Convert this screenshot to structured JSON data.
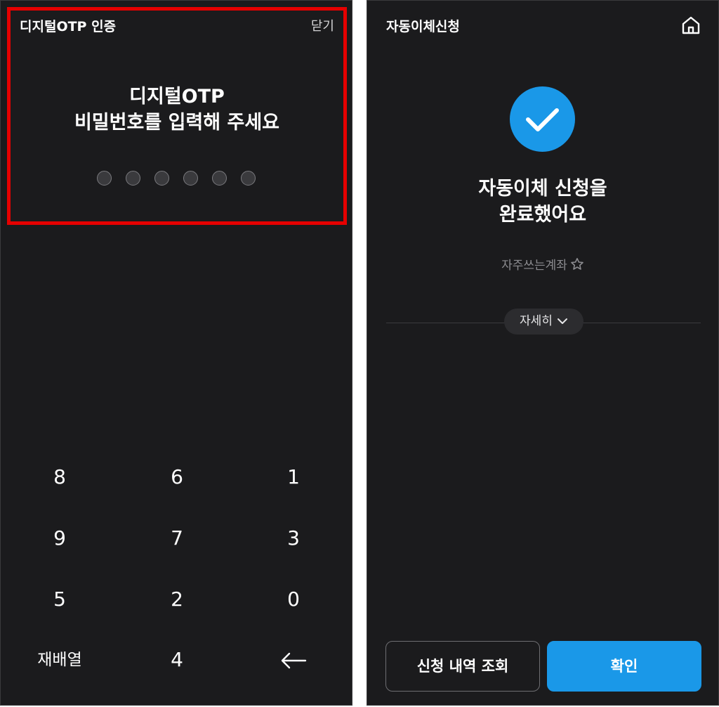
{
  "left": {
    "title": "디지털OTP 인증",
    "close_label": "닫기",
    "heading_line1": "디지털OTP",
    "heading_line2": "비밀번호를 입력해 주세요",
    "pin_length": 6,
    "pin_filled": 0,
    "keypad": [
      [
        "8",
        "6",
        "1"
      ],
      [
        "9",
        "7",
        "3"
      ],
      [
        "5",
        "2",
        "0"
      ],
      [
        "재배열",
        "4",
        "backspace-icon"
      ]
    ],
    "highlight_color": "#e60000"
  },
  "right": {
    "title": "자동이체신청",
    "home_icon": "home-icon",
    "check_icon": "check-icon",
    "heading_line1": "자동이체 신청을",
    "heading_line2": "완료했어요",
    "favorite_label": "자주쓰는계좌",
    "favorite_icon": "star-outline-icon",
    "details_label": "자세히",
    "details_icon": "chevron-down-icon",
    "history_button": "신청 내역 조회",
    "confirm_button": "확인",
    "accent_color": "#1a98e8",
    "background_color": "#1b1b1d"
  }
}
